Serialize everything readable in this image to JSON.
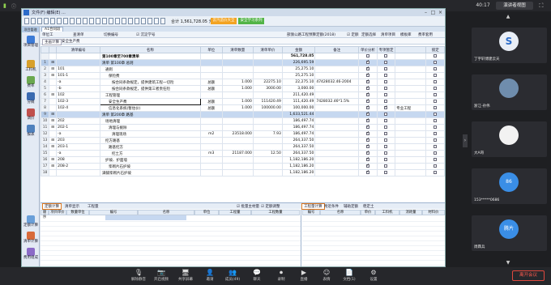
{
  "meeting": {
    "time": "40:17",
    "speaker_view_label": "演讲者视图",
    "leave_label": "离开会议",
    "controls": [
      {
        "label": "解除静音",
        "glyph": "🎙"
      },
      {
        "label": "开启视频",
        "glyph": "📷"
      },
      {
        "label": "共享屏幕",
        "glyph": "🖥"
      },
      {
        "label": "邀请",
        "glyph": "👤"
      },
      {
        "label": "成员(49)",
        "glyph": "👥"
      },
      {
        "label": "聊天",
        "glyph": "💬"
      },
      {
        "label": "录制",
        "glyph": "⏺"
      },
      {
        "label": "直播",
        "glyph": "▶"
      },
      {
        "label": "表情",
        "glyph": "☺"
      },
      {
        "label": "文档(1)",
        "glyph": "📄"
      },
      {
        "label": "设置",
        "glyph": "⚙"
      }
    ],
    "participants": [
      {
        "name": "丁宇轩博建云天",
        "color": "#e9eef6",
        "avatar_text": "S"
      },
      {
        "name": "浙江-孙伟",
        "color": "#6f8dad",
        "avatar_text": ""
      },
      {
        "name": "大A哥",
        "color": "#f2f2f2",
        "avatar_text": ""
      },
      {
        "name": "153*****0686",
        "color": "#3a8ee6",
        "avatar_text": "86"
      },
      {
        "name": "周霖兵",
        "color": "#3a8ee6",
        "avatar_text": "腾片"
      }
    ]
  },
  "app": {
    "menu": "文件(F)  编辑(E)  ...",
    "toolbar_total": "合计 1,561,728.05 元",
    "toolbar_orange": "云汽造价大全",
    "toolbar_green": "安全学习系列",
    "sidebar": [
      {
        "label": "项目管理",
        "color": "#3c7bd6"
      },
      {
        "label": "工料机",
        "color": "#d8a02b"
      },
      {
        "label": "费率",
        "color": "#6aa84f"
      },
      {
        "label": "分摊",
        "color": "#3a6ab0"
      },
      {
        "label": "调价",
        "color": "#c0504d"
      },
      {
        "label": "报表",
        "color": "#4f81bd"
      },
      {
        "label": "定额计算",
        "color": "#6a9fd8"
      },
      {
        "label": "清单计算",
        "color": "#d86a3a"
      },
      {
        "label": "费用组成",
        "color": "#8b6ac7"
      }
    ],
    "sidebar_tab": "项目管理",
    "tabs": [
      "A1合同段"
    ],
    "sub1": [
      "单位工",
      "查清单",
      "切换编号",
      "☑ 沉淀学号",
      "部颁公路工程预算定额(2018)",
      "☑ 定额",
      "定额选择",
      "清单项目",
      "模板库",
      "费率套用"
    ],
    "sub2": [
      "主画计算",
      "安全生产费"
    ],
    "columns": [
      "",
      "",
      "清单编号",
      "名称",
      "单位",
      "清单数量",
      "清单单价",
      "金额",
      "备注",
      "单价分析",
      "专项暂定",
      "",
      "锁定"
    ],
    "rows": [
      {
        "rn": "",
        "exp": "",
        "code": "",
        "name": "第100章至700章清单",
        "unit": "",
        "qty": "",
        "price": "",
        "amount": "561,728.05",
        "note": "",
        "c1": false,
        "c2": false,
        "lock": false,
        "style": "bold"
      },
      {
        "rn": "1",
        "exp": "⊟",
        "code": "",
        "name": "清单 第100章  总则",
        "unit": "",
        "qty": "",
        "price": "",
        "amount": "226,695.59",
        "note": "",
        "c1": true,
        "c2": false,
        "lock": false,
        "style": "hl"
      },
      {
        "rn": "2",
        "exp": "⊟",
        "code": "101",
        "name": "通则",
        "unit": "",
        "qty": "",
        "price": "",
        "amount": "25,275.10",
        "note": "",
        "c1": true,
        "c2": false,
        "lock": false,
        "style": ""
      },
      {
        "rn": "3",
        "exp": "⊟",
        "code": "101-1",
        "name": "保险费",
        "unit": "",
        "qty": "",
        "price": "",
        "amount": "25,275.10",
        "note": "",
        "c1": true,
        "c2": false,
        "lock": false,
        "style": ""
      },
      {
        "rn": "4",
        "exp": "",
        "code": "-a",
        "name": "按合同条款规定，提供建筑工程一切险",
        "unit": "总额",
        "qty": "1.000",
        "price": "22275.10",
        "amount": "22,275.10",
        "note": "47428032.46-2004",
        "c1": true,
        "c2": false,
        "lock": false,
        "style": ""
      },
      {
        "rn": "5",
        "exp": "",
        "code": "-b",
        "name": "按合同条款规定，提供第三者责任险",
        "unit": "总额",
        "qty": "1.000",
        "price": "3000.00",
        "amount": "3,000.00",
        "note": "",
        "c1": true,
        "c2": false,
        "lock": false,
        "style": ""
      },
      {
        "rn": "6",
        "exp": "⊟",
        "code": "102",
        "name": "工程管理",
        "unit": "",
        "qty": "",
        "price": "",
        "amount": "211,420.49",
        "note": "",
        "c1": true,
        "c2": false,
        "lock": false,
        "style": ""
      },
      {
        "rn": "7",
        "exp": "",
        "code": "102-3",
        "name": "安全生产费",
        "unit": "总额",
        "qty": "1.000",
        "price": "111420.49",
        "amount": "111,420.49",
        "note": "7428032.46*1.5%",
        "c1": true,
        "c2": false,
        "lock": false,
        "style": "sel"
      },
      {
        "rn": "8",
        "exp": "",
        "code": "102-4",
        "name": "信息化系统(暂估价)",
        "unit": "总额",
        "qty": "1.000",
        "price": "100000.00",
        "amount": "100,000.00",
        "note": "",
        "c1": true,
        "c2": true,
        "lock": false,
        "style": "",
        "extra": "专业工程"
      },
      {
        "rn": "9",
        "exp": "⊟",
        "code": "",
        "name": "清单 第200章  路基",
        "unit": "",
        "qty": "",
        "price": "",
        "amount": "1,633,521.44",
        "note": "",
        "c1": true,
        "c2": false,
        "lock": false,
        "style": "hl"
      },
      {
        "rn": "10",
        "exp": "⊟",
        "code": "202",
        "name": "场地清理",
        "unit": "",
        "qty": "",
        "price": "",
        "amount": "186,497.74",
        "note": "",
        "c1": true,
        "c2": false,
        "lock": false,
        "style": ""
      },
      {
        "rn": "11",
        "exp": "⊟",
        "code": "202-1",
        "name": "清理与掘除",
        "unit": "",
        "qty": "",
        "price": "",
        "amount": "186,497.74",
        "note": "",
        "c1": true,
        "c2": false,
        "lock": false,
        "style": ""
      },
      {
        "rn": "12",
        "exp": "",
        "code": "-a",
        "name": "清理现场",
        "unit": "m2",
        "qty": "23518.000",
        "price": "7.93",
        "amount": "186,497.74",
        "note": "",
        "c1": true,
        "c2": false,
        "lock": false,
        "style": ""
      },
      {
        "rn": "13",
        "exp": "⊟",
        "code": "203",
        "name": "挖方路基",
        "unit": "",
        "qty": "",
        "price": "",
        "amount": "264,337.50",
        "note": "",
        "c1": true,
        "c2": false,
        "lock": false,
        "style": ""
      },
      {
        "rn": "14",
        "exp": "⊟",
        "code": "203-1",
        "name": "路基挖方",
        "unit": "",
        "qty": "",
        "price": "",
        "amount": "264,337.50",
        "note": "",
        "c1": true,
        "c2": false,
        "lock": false,
        "style": ""
      },
      {
        "rn": "15",
        "exp": "",
        "code": "-a",
        "name": "挖土方",
        "unit": "m3",
        "qty": "21187.000",
        "price": "12.50",
        "amount": "264,337.50",
        "note": "",
        "c1": true,
        "c2": false,
        "lock": false,
        "style": ""
      },
      {
        "rn": "16",
        "exp": "⊟",
        "code": "208",
        "name": "护坡、护面墙",
        "unit": "",
        "qty": "",
        "price": "",
        "amount": "1,182,186.20",
        "note": "",
        "c1": true,
        "c2": false,
        "lock": false,
        "style": ""
      },
      {
        "rn": "17",
        "exp": "⊟",
        "code": "208-2",
        "name": "浆砌片石护坡",
        "unit": "",
        "qty": "",
        "price": "",
        "amount": "1,182,186.20",
        "note": "",
        "c1": true,
        "c2": false,
        "lock": false,
        "style": ""
      },
      {
        "rn": "18",
        "exp": "",
        "code": "",
        "name": "满铺浆砌片石护坡",
        "unit": "",
        "qty": "",
        "price": "",
        "amount": "1,182,186.20",
        "note": "",
        "c1": true,
        "c2": false,
        "lock": false,
        "style": ""
      }
    ],
    "bottom_tabs": [
      "定额计算",
      "清单显示",
      "工程量",
      "☑ 批量主材量",
      "☑ 定额调整",
      "工程量计算",
      "附近条件",
      "辅助定额",
      "稳定土"
    ],
    "bottom_left_headers": [
      "顺序",
      "项目单价",
      "数量单位",
      "编号",
      "名称",
      "单位",
      "工程量",
      "工程数量"
    ],
    "bottom_right_headers": [
      "编号",
      "名称",
      "单价",
      "工料机",
      "消耗量",
      "材料价"
    ]
  }
}
